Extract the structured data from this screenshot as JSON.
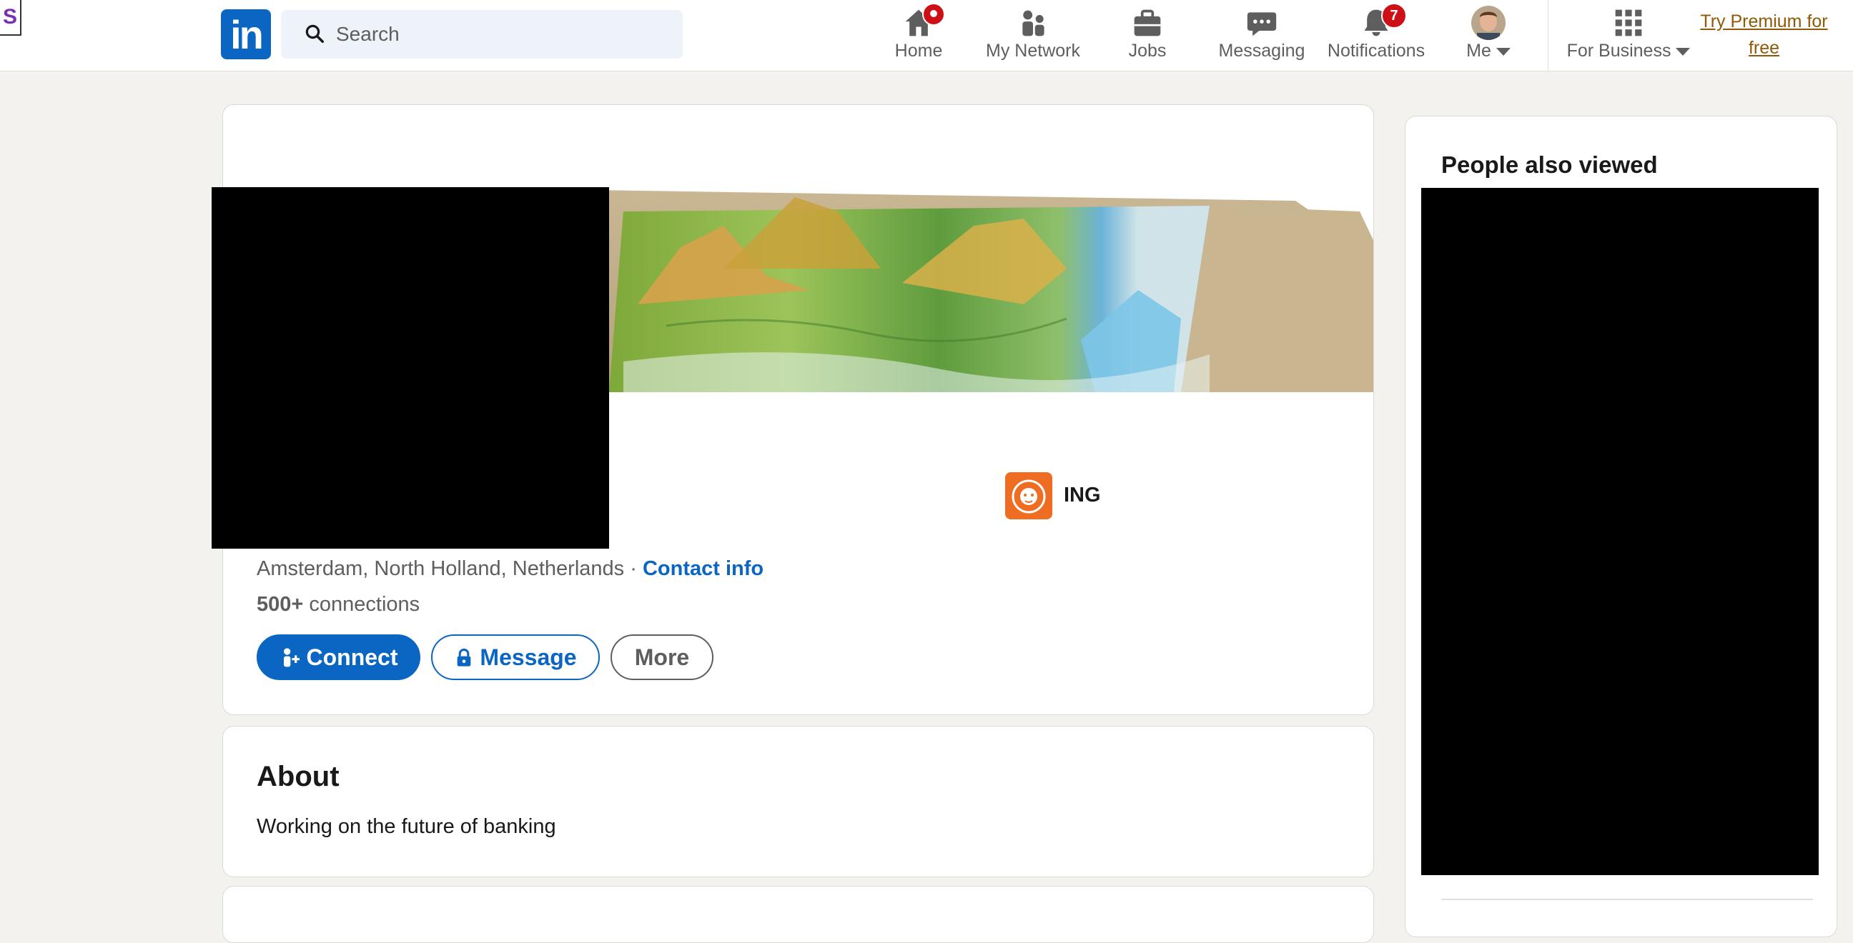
{
  "extension": {
    "letter": "S"
  },
  "nav": {
    "logo_text": "in",
    "search_placeholder": "Search",
    "items": [
      {
        "label": "Home",
        "icon": "home-icon",
        "badge": ""
      },
      {
        "label": "My Network",
        "icon": "network-icon"
      },
      {
        "label": "Jobs",
        "icon": "briefcase-icon"
      },
      {
        "label": "Messaging",
        "icon": "messaging-icon"
      },
      {
        "label": "Notifications",
        "icon": "bell-icon",
        "badge": "7"
      },
      {
        "label": "Me",
        "icon": "avatar"
      }
    ],
    "for_business": "For Business",
    "premium_line1": "Try Premium for",
    "premium_line2": "free"
  },
  "profile": {
    "company": "ING",
    "location": "Amsterdam, North Holland, Netherlands",
    "separator": " · ",
    "contact_info": "Contact info",
    "connections_count": "500+",
    "connections_label": " connections",
    "buttons": {
      "connect": "Connect",
      "message": "Message",
      "more": "More"
    }
  },
  "about": {
    "title": "About",
    "text": "Working on the future of banking"
  },
  "sidebar": {
    "title": "People also viewed"
  },
  "colors": {
    "brand": "#0a66c2",
    "badge": "#cc1016",
    "ing_orange": "#ee6d22",
    "premium": "#915907"
  }
}
